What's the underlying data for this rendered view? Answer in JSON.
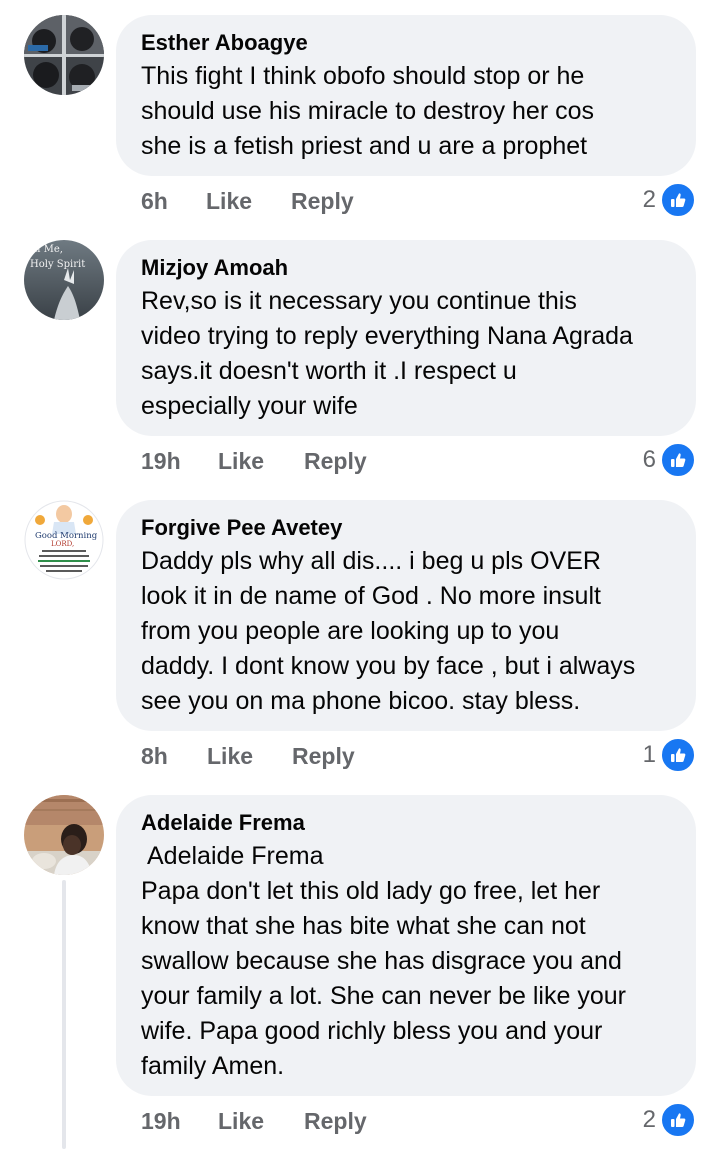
{
  "comments": [
    {
      "author": "Esther Aboagye",
      "text": "This fight I think obofo should stop or he\nshould use his miracle to destroy her cos\nshe is a fetish priest and u are a prophet",
      "time": "6h",
      "like_label": "Like",
      "reply_label": "Reply",
      "reaction_count": "2",
      "reaction_icon": "thumbs-up-icon"
    },
    {
      "author": "Mizjoy Amoah",
      "avatar_text_1": "ll Me,",
      "avatar_text_2": "Holy Spirit",
      "text": "Rev,so is it necessary you continue this\nvideo trying to reply everything Nana Agrada\nsays.it doesn't worth it .I respect u\nespecially your wife",
      "time": "19h",
      "like_label": "Like",
      "reply_label": "Reply",
      "reaction_count": "6",
      "reaction_icon": "thumbs-up-icon"
    },
    {
      "author": "Forgive Pee Avetey",
      "avatar_text_1": "Good Morning",
      "avatar_text_2": "LORD,",
      "text": "Daddy pls why all dis.... i beg u pls OVER\nlook it in de name of God . No more insult\nfrom you people are looking up to you\ndaddy. I dont know you by face , but i always\nsee you on ma phone bicoo. stay bless.",
      "time": "8h",
      "like_label": "Like",
      "reply_label": "Reply",
      "reaction_count": "1",
      "reaction_icon": "thumbs-up-icon"
    },
    {
      "author": "Adelaide Frema",
      "mention": "Adelaide Frema",
      "text": "Papa don't let this old lady go free, let her\nknow that she has bite what she can not\nswallow because she has disgrace you and\nyour family a lot.  She can never be like your\nwife. Papa good richly bless you and your\nfamily Amen.",
      "time": "19h",
      "like_label": "Like",
      "reply_label": "Reply",
      "reaction_count": "2",
      "reaction_icon": "thumbs-up-icon"
    }
  ],
  "colors": {
    "bubble": "#f0f2f5",
    "meta_text": "#65676b",
    "like_blue": "#1877f2"
  }
}
